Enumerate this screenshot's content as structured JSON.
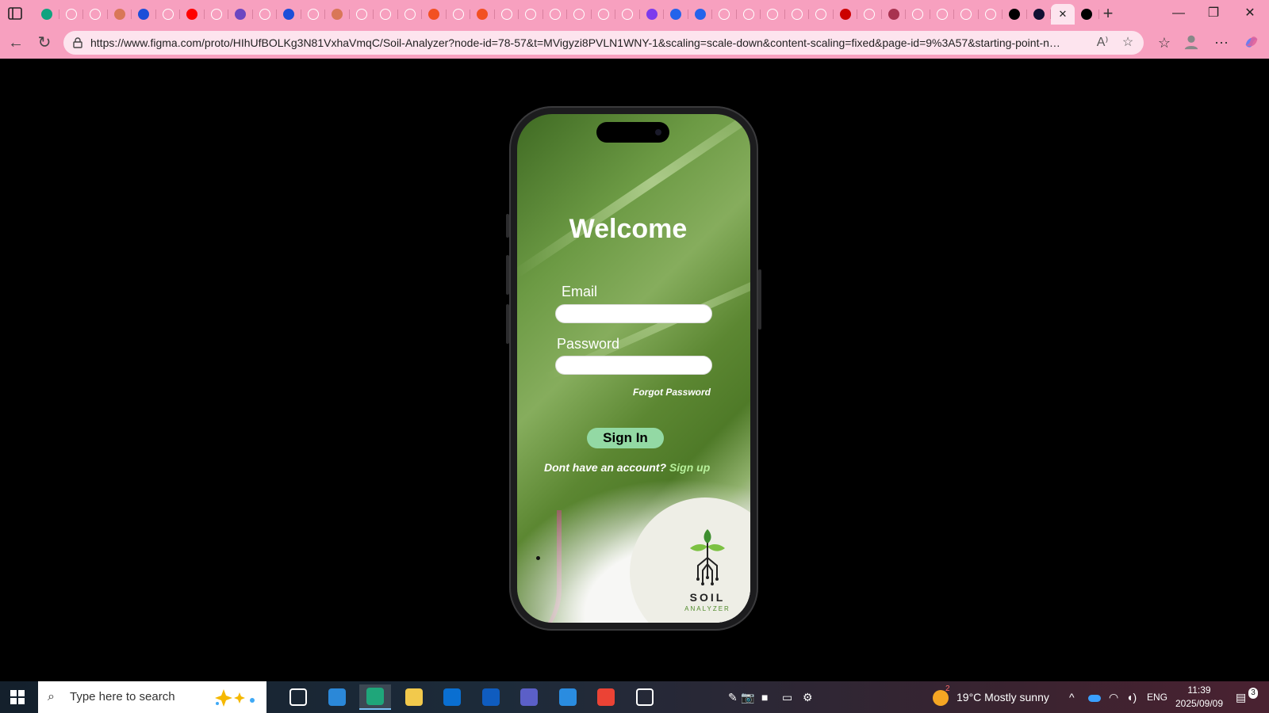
{
  "browser": {
    "tabs": [
      {
        "icon": "chatgpt-icon",
        "color": "#10a37f"
      },
      {
        "icon": "openai-icon",
        "color": "#ffffff"
      },
      {
        "icon": "openai-icon",
        "color": "#ffffff"
      },
      {
        "icon": "claude-icon",
        "color": "#d97757"
      },
      {
        "icon": "shield-icon",
        "color": "#1d4ed8"
      },
      {
        "icon": "search-icon",
        "color": "#ffffff"
      },
      {
        "icon": "youtube-icon",
        "color": "#ff0000"
      },
      {
        "icon": "globe-icon",
        "color": "#ffffff"
      },
      {
        "icon": "artifact-icon",
        "color": "#6b46c1"
      },
      {
        "icon": "openai-icon",
        "color": "#ffffff"
      },
      {
        "icon": "shield-icon",
        "color": "#1d4ed8"
      },
      {
        "icon": "globe-icon",
        "color": "#ffffff"
      },
      {
        "icon": "claude-icon",
        "color": "#d97757"
      },
      {
        "icon": "openai-icon",
        "color": "#ffffff"
      },
      {
        "icon": "openai-icon",
        "color": "#ffffff"
      },
      {
        "icon": "github-icon",
        "color": "#ffffff"
      },
      {
        "icon": "microsoft-icon",
        "color": "#f25022"
      },
      {
        "icon": "doc-icon",
        "color": "#ffffff"
      },
      {
        "icon": "microsoft-icon",
        "color": "#f25022"
      },
      {
        "icon": "globe-icon",
        "color": "#ffffff"
      },
      {
        "icon": "globe-icon",
        "color": "#ffffff"
      },
      {
        "icon": "doc-icon",
        "color": "#ffffff"
      },
      {
        "icon": "globe-icon",
        "color": "#ffffff"
      },
      {
        "icon": "globe-icon",
        "color": "#ffffff"
      },
      {
        "icon": "search-icon",
        "color": "#ffffff"
      },
      {
        "icon": "copilot-icon",
        "color": "#7c3aed"
      },
      {
        "icon": "copilot-icon",
        "color": "#2563eb"
      },
      {
        "icon": "copilot-icon",
        "color": "#2563eb"
      },
      {
        "icon": "globe-icon",
        "color": "#ffffff"
      },
      {
        "icon": "globe-icon",
        "color": "#ffffff"
      },
      {
        "icon": "globe-icon",
        "color": "#ffffff"
      },
      {
        "icon": "globe-icon",
        "color": "#ffffff"
      },
      {
        "icon": "globe-icon",
        "color": "#ffffff"
      },
      {
        "icon": "pdf-icon",
        "color": "#cc0000"
      },
      {
        "icon": "globe-icon",
        "color": "#ffffff"
      },
      {
        "icon": "image-icon",
        "color": "#a83250"
      },
      {
        "icon": "globe-icon",
        "color": "#ffffff"
      },
      {
        "icon": "doc-icon",
        "color": "#ffffff"
      },
      {
        "icon": "globe-icon",
        "color": "#ffffff"
      },
      {
        "icon": "globe-icon",
        "color": "#ffffff"
      },
      {
        "icon": "globe-icon",
        "color": "#000000"
      },
      {
        "icon": "figma-icon",
        "color": "#111133"
      },
      {
        "icon": "close-icon",
        "color": "#222222",
        "active": true
      },
      {
        "icon": "globe-icon",
        "color": "#000000"
      }
    ],
    "url": "https://www.figma.com/proto/HIhUfBOLKg3N81VxhaVmqC/Soil-Analyzer?node-id=78-57&t=MVigyzi8PVLN1WNY-1&scaling=scale-down&content-scaling=fixed&page-id=9%3A57&starting-point-nod...",
    "accent": "#f7a0bf"
  },
  "app": {
    "welcome": "Welcome",
    "email_label": "Email",
    "password_label": "Password",
    "forgot": "Forgot Password",
    "signin": "Sign In",
    "no_account": "Dont have an account?",
    "signup": "Sign up",
    "logo_title": "SOIL",
    "logo_sub": "ANALYZER",
    "button_color": "#93d9a4",
    "link_color": "#b6ef9a"
  },
  "taskbar": {
    "search_placeholder": "Type here to search",
    "apps": [
      {
        "icon": "task-view-icon",
        "color": "#ffffff"
      },
      {
        "icon": "microsoft-store-icon",
        "color": "#2b88d8"
      },
      {
        "icon": "edge-icon",
        "color": "#1fa67a",
        "active": true
      },
      {
        "icon": "file-explorer-icon",
        "color": "#f2c94c"
      },
      {
        "icon": "outlook-icon",
        "color": "#0a6fd1"
      },
      {
        "icon": "outlook-classic-icon",
        "color": "#0f5cbf"
      },
      {
        "icon": "teams-icon",
        "color": "#5b5fc7"
      },
      {
        "icon": "vscode-icon",
        "color": "#2a8ce0"
      },
      {
        "icon": "chrome-icon",
        "color": "#eb4335"
      },
      {
        "icon": "settings-icon",
        "color": "#ffffff"
      }
    ],
    "weather_badge": "2",
    "weather": "19°C  Mostly sunny",
    "language": "ENG",
    "time": "11:39",
    "date": "2025/09/09",
    "notifications": "3"
  }
}
